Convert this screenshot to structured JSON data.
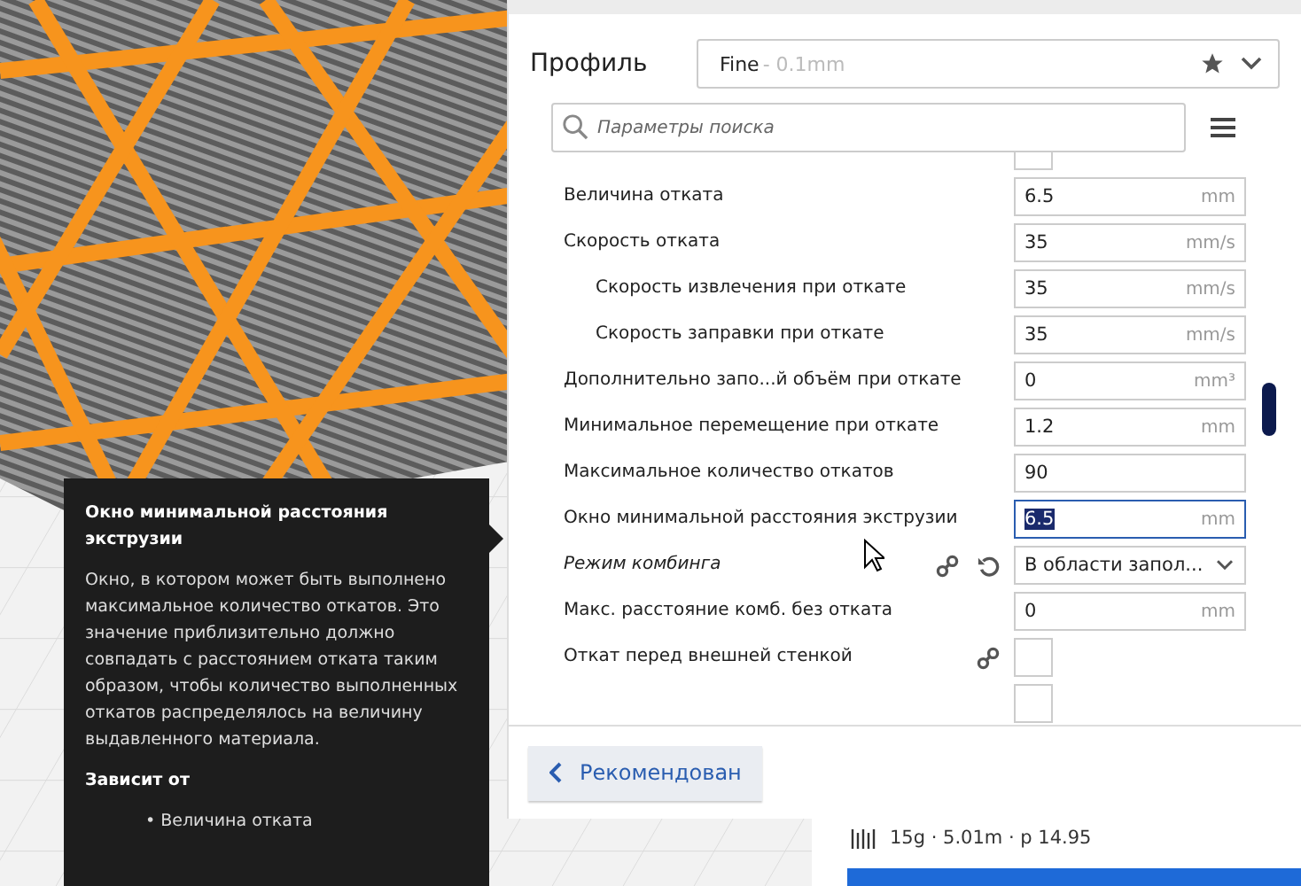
{
  "profile": {
    "label": "Профиль",
    "name": "Fine",
    "detail": "- 0.1mm"
  },
  "search": {
    "placeholder": "Параметры поиска"
  },
  "settings": [
    {
      "kind": "checkbox",
      "checked": false
    },
    {
      "kind": "number",
      "label": "Величина отката",
      "value": "6.5",
      "unit": "mm",
      "focused": false
    },
    {
      "kind": "number",
      "label": "Скорость отката",
      "value": "35",
      "unit": "mm/s",
      "focused": false,
      "children": [
        {
          "kind": "number",
          "label": "Скорость извлечения при откате",
          "value": "35",
          "unit": "mm/s",
          "focused": false
        },
        {
          "kind": "number",
          "label": "Скорость заправки при откате",
          "value": "35",
          "unit": "mm/s",
          "focused": false
        }
      ]
    },
    {
      "kind": "number",
      "label": "Дополнительно запо...й объём при откате",
      "value": "0",
      "unit": "mm³",
      "focused": false
    },
    {
      "kind": "number",
      "label": "Минимальное перемещение при откате",
      "value": "1.2",
      "unit": "mm",
      "focused": false
    },
    {
      "kind": "number",
      "label": "Максимальное количество откатов",
      "value": "90",
      "focused": false
    },
    {
      "kind": "number",
      "label": "Окно минимальной расстояния экструзии",
      "value": "6.5",
      "unit": "mm",
      "focused": true
    },
    {
      "kind": "select",
      "label": "Режим комбинга",
      "value": "В области запол...",
      "linked": true,
      "modified": true
    },
    {
      "kind": "number",
      "label": "Макс. расстояние комб. без отката",
      "value": "0",
      "unit": "mm",
      "focused": false
    },
    {
      "kind": "checkbox",
      "label": "Откат перед внешней стенкой",
      "checked": false,
      "linked": true
    },
    {
      "kind": "checkbox",
      "checked": false
    }
  ],
  "recommended_button": "Рекомендован",
  "print_info": "15g · 5.01m · р 14.95",
  "tooltip": {
    "title": "Окно минимальной расстояния экструзии",
    "body": "Окно, в котором может быть выполнено максимальное количество откатов. Это значение приблизительно должно совпадать с расстоянием отката таким образом, чтобы количество выполненных откатов распределялось на величину выдавленного материала.",
    "depends_heading": "Зависит от",
    "depends": [
      "• Величина отката"
    ]
  }
}
